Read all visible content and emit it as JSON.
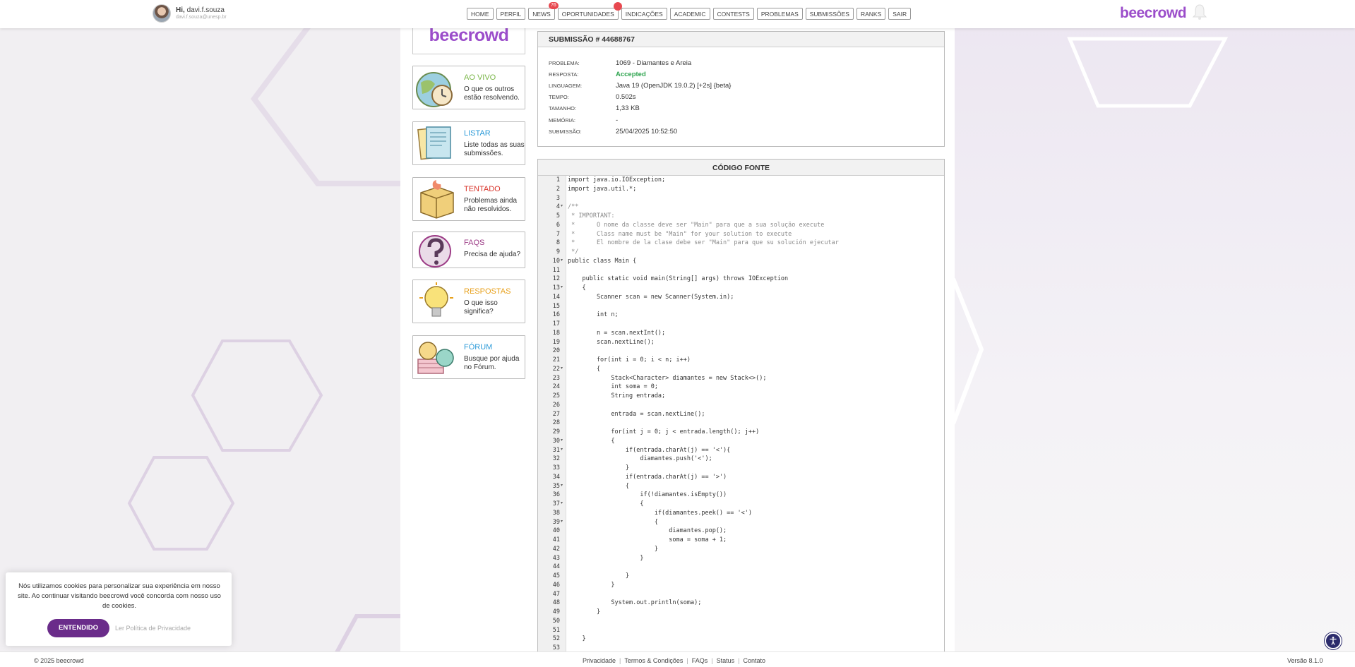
{
  "user": {
    "greeting_prefix": "Hi,",
    "username": "davi.f.souza",
    "email": "davi.f.souza@unesp.br"
  },
  "nav": {
    "items": [
      "HOME",
      "PERFIL",
      "NEWS",
      "OPORTUNIDADES",
      "INDICAÇÕES",
      "ACADEMIC",
      "CONTESTS",
      "PROBLEMAS",
      "SUBMISSÕES",
      "RANKS",
      "SAIR"
    ],
    "news_badge": "76"
  },
  "brand": {
    "logo": "beecrowd",
    "accent": "#9b4dca"
  },
  "sidebar": {
    "logo": "beecrowd",
    "cards": [
      {
        "title": "AO VIVO",
        "desc": "O que os outros estão resolvendo.",
        "color": "#7ab648"
      },
      {
        "title": "LISTAR",
        "desc": "Liste todas as suas submissões.",
        "color": "#2b9ad8"
      },
      {
        "title": "TENTADO",
        "desc": "Problemas ainda não resolvidos.",
        "color": "#d9342b"
      },
      {
        "title": "FAQS",
        "desc": "Precisa de ajuda?",
        "color": "#9c3c86"
      },
      {
        "title": "RESPOSTAS",
        "desc": "O que isso significa?",
        "color": "#e8a11c"
      },
      {
        "title": "FÓRUM",
        "desc": "Busque por ajuda no Fórum.",
        "color": "#2b9ad8"
      }
    ]
  },
  "submission": {
    "header": "SUBMISSÃO # 44688767",
    "rows": [
      {
        "label": "PROBLEMA:",
        "value": "1069 - Diamantes e Areia"
      },
      {
        "label": "RESPOSTA:",
        "value": "Accepted"
      },
      {
        "label": "LINGUAGEM:",
        "value": "Java 19 (OpenJDK 19.0.2) [+2s] {beta}"
      },
      {
        "label": "TEMPO:",
        "value": "0.502s"
      },
      {
        "label": "TAMANHO:",
        "value": "1,33 KB"
      },
      {
        "label": "MEMÓRIA:",
        "value": "-"
      },
      {
        "label": "SUBMISSÃO:",
        "value": "25/04/2025 10:52:50"
      }
    ]
  },
  "code": {
    "header": "CÓDIGO FONTE",
    "lines": [
      "import java.io.IOException;",
      "import java.util.*;",
      "",
      "/**",
      " * IMPORTANT:",
      " *      O nome da classe deve ser \"Main\" para que a sua solução execute",
      " *      Class name must be \"Main\" for your solution to execute",
      " *      El nombre de la clase debe ser \"Main\" para que su solución ejecutar",
      " */",
      "public class Main {",
      "",
      "    public static void main(String[] args) throws IOException",
      "    {",
      "        Scanner scan = new Scanner(System.in);",
      "",
      "        int n;",
      "",
      "        n = scan.nextInt();",
      "        scan.nextLine();",
      "",
      "        for(int i = 0; i < n; i++)",
      "        {",
      "            Stack<Character> diamantes = new Stack<>();",
      "            int soma = 0;",
      "            String entrada;",
      "",
      "            entrada = scan.nextLine();",
      "",
      "            for(int j = 0; j < entrada.length(); j++)",
      "            {",
      "                if(entrada.charAt(j) == '<'){",
      "                    diamantes.push('<');",
      "                }",
      "                if(entrada.charAt(j) == '>')",
      "                {",
      "                    if(!diamantes.isEmpty())",
      "                    {",
      "                        if(diamantes.peek() == '<')",
      "                        {",
      "                            diamantes.pop();",
      "                            soma = soma + 1;",
      "                        }",
      "                    }",
      "",
      "                }",
      "            }",
      "",
      "            System.out.println(soma);",
      "        }",
      "",
      "",
      "    }",
      ""
    ],
    "fold_lines": [
      4,
      10,
      13,
      22,
      30,
      31,
      35,
      37,
      39
    ],
    "comment_lines": [
      4,
      5,
      6,
      7,
      8,
      9
    ]
  },
  "cookie": {
    "text": "Nós utilizamos cookies para personalizar sua experiência em nosso site. Ao continuar visitando beecrowd você concorda com nosso uso de cookies.",
    "button": "ENTENDIDO",
    "link": "Ler Política de Privacidade"
  },
  "footer": {
    "copyright": "© 2025 beecrowd",
    "links": [
      "Privacidade",
      "Termos & Condições",
      "FAQs",
      "Status",
      "Contato"
    ],
    "version": "Versão 8.1.0"
  }
}
